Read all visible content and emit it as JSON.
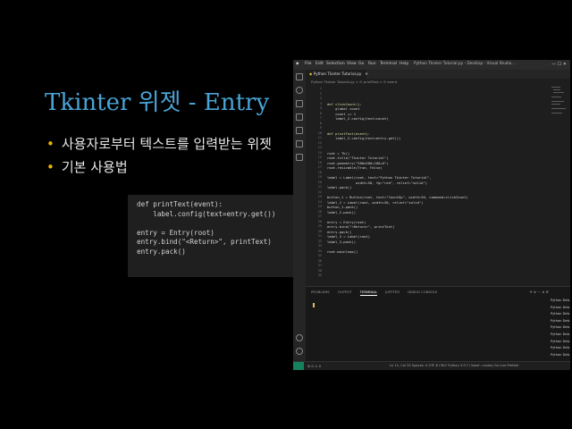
{
  "slide": {
    "title": "Tkinter 위젯 - Entry",
    "bullets": [
      "사용자로부터 텍스트를 입력받는 위젯",
      "기본 사용법"
    ],
    "code": [
      "def printText(event):",
      "    label.config(text=entry.get())",
      "",
      "entry = Entry(root)",
      "entry.bind(\"<Return>\", printText)",
      "entry.pack()"
    ]
  },
  "vscode": {
    "menu": [
      "File",
      "Edit",
      "Selection",
      "View",
      "Go",
      "Run",
      "Terminal",
      "Help"
    ],
    "window_title": "Python Tkinter Tutorial.py - Desktop - Visual Studio ...",
    "window_buttons": "—  ☐  ✕",
    "tab_label": "Python Tkinter Tutorial.py",
    "breadcrumb": "Python Tkinter Tutorial.py > ⊙ printText > ⊙ event",
    "line_numbers": [
      "1",
      "2",
      "3",
      "4",
      "5",
      "6",
      "7",
      "8",
      "9",
      "10",
      "11",
      "12",
      "13",
      "14",
      "15",
      "16",
      "17",
      "18",
      "19",
      "20",
      "21",
      "22",
      "23",
      "24",
      "25",
      "26",
      "27",
      "28",
      "29",
      "30",
      "31",
      "32",
      "33",
      "34",
      "35",
      "36",
      "37",
      "38",
      "39"
    ],
    "code_lines": [
      "",
      "",
      "",
      "def clickCount():",
      "    global count",
      "    count += 1",
      "    label_2.config(text=count)",
      "",
      "",
      "def printText(event):",
      "    label_3.config(text=entry.get())",
      "",
      "",
      "root = Tk()",
      "root.title(\"Tkinter Tutorial\")",
      "root.geometry(\"500x500+100+0\")",
      "root.resizable(True, False)",
      "",
      "label = Label(root, text=\"Python Tkinter Tutorial\",",
      "              width=50, fg=\"red\", relief=\"solid\")",
      "label.pack()",
      "",
      "button_1 = Button(root, text=\"CountUp\", width=30, command=clickCount)",
      "label_2 = Label(root, width=30, relief=\"solid\")",
      "button_1.pack()",
      "label_2.pack()",
      "",
      "entry = Entry(root)",
      "entry.bind(\"<Return>\", printText)",
      "entry.pack()",
      "label_3 = Label(root)",
      "label_3.pack()",
      "",
      "root.mainloop()",
      "",
      "",
      "",
      "",
      ""
    ],
    "panel_tabs": [
      "PROBLEMS",
      "OUTPUT",
      "TERMINAL",
      "JUPYTER",
      "DEBUG CONSOLE"
    ],
    "panel_actions": "+ ∨  ⋯  ∧  ✕",
    "terminal_items": [
      "Python Deb...",
      "Python Deb...",
      "Python Deb...",
      "Python Deb...",
      "Python Deb...",
      "Python Deb...",
      "Python Deb...",
      "Python Deb...",
      "Python Deb..."
    ],
    "status_left": "⊗ 0 ⚠ 0",
    "status_right": "Ln 11, Col 33   Spaces: 4   UTF-8   CRLF   Python   3.9.7 ('base': conda)   Go Live   Prettier"
  }
}
